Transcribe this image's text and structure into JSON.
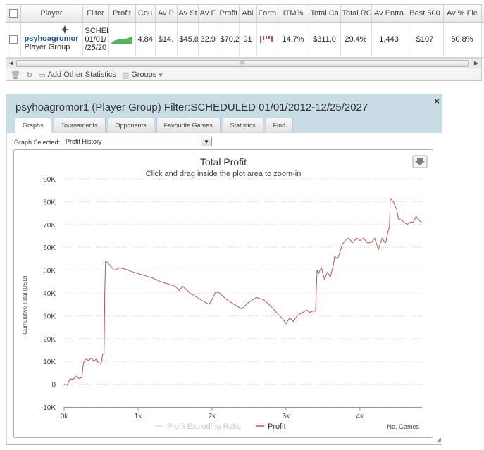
{
  "grid": {
    "columns": [
      "Player",
      "Filter",
      "Profit",
      "Cou",
      "Av P",
      "Av St",
      "Av F",
      "Profit",
      "Abi",
      "Form",
      "ITM%",
      "Total Ca",
      "Total RC",
      "Av Entra",
      "Best 500",
      "Av % Fie"
    ],
    "row": {
      "player_name": "psyhoagromor",
      "player_sub": "Player Group",
      "filter_lines": [
        "SCHED",
        "01/01/",
        "/25/20"
      ],
      "count": "4,84",
      "av_profit": "$14.",
      "av_stake": "$45.8",
      "av_field": "32.9",
      "profit": "$70,2",
      "abi": "91",
      "itm": "14.7%",
      "total_cash": "$311,0",
      "total_roi": "29.4%",
      "av_entrants": "1,443",
      "best_500": "$107",
      "av_pct_field": "50.8%",
      "close_label": "x"
    },
    "scroll_thumb_glyph": "III"
  },
  "toolbar": {
    "add_stats_label": "Add Other Statistics",
    "groups_label": "Groups"
  },
  "window": {
    "title": "psyhoagromor1 (Player Group) Filter:SCHEDULED 01/01/2012-12/25/2027",
    "close_glyph": "×",
    "tabs": [
      {
        "label": "Graphs",
        "active": true
      },
      {
        "label": "Tournaments",
        "active": false
      },
      {
        "label": "Opponents",
        "active": false
      },
      {
        "label": "Favourite Games",
        "active": false
      },
      {
        "label": "Statistics",
        "active": false
      },
      {
        "label": "Find",
        "active": false
      }
    ],
    "graph_selected_label": "Graph Selected:",
    "graph_selected_value": "Profit History",
    "resize_glyph": "◢"
  },
  "chart_data": {
    "type": "line",
    "title": "Total Profit",
    "subtitle": "Click and drag inside the plot area to zoom-in",
    "ylabel": "Cumulative Total (USD)",
    "xlabel": "No. Games",
    "ylim": [
      -10000,
      90000
    ],
    "xlim": [
      0,
      4840
    ],
    "y_ticks": [
      -10000,
      0,
      10000,
      20000,
      30000,
      40000,
      50000,
      60000,
      70000,
      80000,
      90000
    ],
    "y_tick_labels": [
      "-10K",
      "0",
      "10K",
      "20K",
      "30K",
      "40K",
      "50K",
      "60K",
      "70K",
      "80K",
      "90K"
    ],
    "x_ticks": [
      0,
      1000,
      2000,
      3000,
      4000
    ],
    "x_tick_labels": [
      "0k",
      "1k",
      "2k",
      "3k",
      "4k"
    ],
    "grid": true,
    "legend_position": "bottom",
    "series": [
      {
        "name": "Profit Excluding Rake",
        "color": "#dcdcdc",
        "x": [],
        "y": []
      },
      {
        "name": "Profit",
        "color": "#b85450",
        "x": [
          0,
          40,
          80,
          120,
          160,
          200,
          240,
          260,
          290,
          330,
          370,
          400,
          430,
          460,
          500,
          520,
          540,
          550,
          560,
          580,
          620,
          680,
          750,
          820,
          900,
          1000,
          1100,
          1200,
          1300,
          1400,
          1500,
          1560,
          1600,
          1700,
          1800,
          1900,
          1960,
          2000,
          2050,
          2100,
          2200,
          2300,
          2400,
          2500,
          2600,
          2700,
          2800,
          2900,
          2960,
          3000,
          3050,
          3100,
          3150,
          3200,
          3280,
          3320,
          3360,
          3400,
          3420,
          3440,
          3460,
          3480,
          3520,
          3560,
          3600,
          3640,
          3660,
          3700,
          3740,
          3760,
          3800,
          3850,
          3900,
          3960,
          4000,
          4050,
          4100,
          4150,
          4200,
          4250,
          4300,
          4340,
          4350,
          4380,
          4400,
          4410,
          4450,
          4480,
          4500,
          4520,
          4560,
          4600,
          4640,
          4680,
          4720,
          4760,
          4800,
          4840
        ],
        "y": [
          0,
          -500,
          2500,
          2000,
          3500,
          2500,
          3000,
          9000,
          11000,
          10500,
          11500,
          10000,
          11000,
          9500,
          9000,
          13000,
          13500,
          40000,
          54000,
          53500,
          52000,
          50000,
          51000,
          50500,
          49500,
          48500,
          47500,
          46500,
          45000,
          44000,
          43000,
          41000,
          43000,
          40000,
          38000,
          36000,
          35000,
          37000,
          40500,
          40000,
          37000,
          35000,
          33000,
          36000,
          38000,
          37000,
          34000,
          30500,
          28500,
          26500,
          29000,
          27500,
          30000,
          31000,
          32500,
          31500,
          32000,
          32000,
          50000,
          48500,
          50000,
          51000,
          46000,
          49000,
          47000,
          52000,
          56000,
          55000,
          59000,
          61000,
          63000,
          64000,
          62000,
          64000,
          63000,
          64000,
          62000,
          62000,
          64000,
          59000,
          64000,
          62000,
          62000,
          67000,
          69000,
          81500,
          80000,
          78000,
          76500,
          72500,
          72000,
          71000,
          70000,
          71000,
          71000,
          73500,
          72000,
          70500
        ]
      }
    ]
  }
}
